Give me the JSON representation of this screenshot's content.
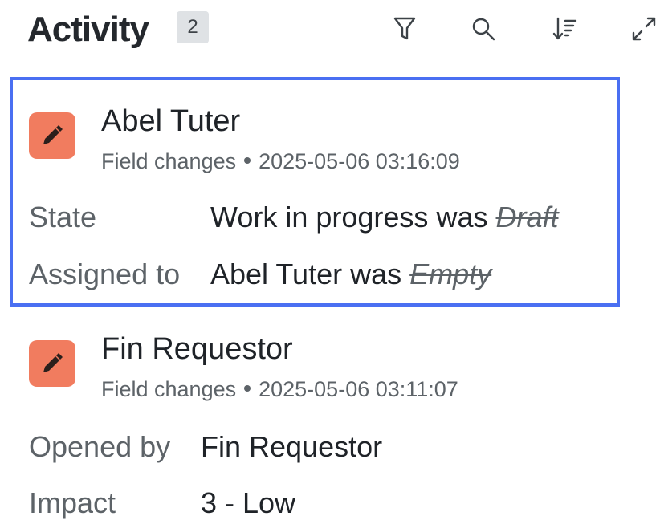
{
  "header": {
    "title": "Activity",
    "count": "2",
    "icons": [
      "filter-icon",
      "search-icon",
      "sort-icon",
      "expand-icon"
    ]
  },
  "colors": {
    "avatar": "#f17c5f",
    "selection_border": "#4a6ff2",
    "count_badge": "#dfe2e5"
  },
  "entries": [
    {
      "user": "Abel Tuter",
      "type": "Field changes",
      "timestamp": "2025-05-06 03:16:09",
      "icon": "pencil-icon",
      "selected": true,
      "changes": [
        {
          "label": "State",
          "new": "Work in progress",
          "was": "was",
          "old": "Draft"
        },
        {
          "label": "Assigned to",
          "new": "Abel Tuter",
          "was": "was",
          "old": "Empty"
        }
      ]
    },
    {
      "user": "Fin Requestor",
      "type": "Field changes",
      "timestamp": "2025-05-06 03:11:07",
      "icon": "pencil-icon",
      "selected": false,
      "changes": [
        {
          "label": "Opened by",
          "new": "Fin Requestor"
        },
        {
          "label": "Impact",
          "new": "3 - Low"
        }
      ]
    }
  ]
}
